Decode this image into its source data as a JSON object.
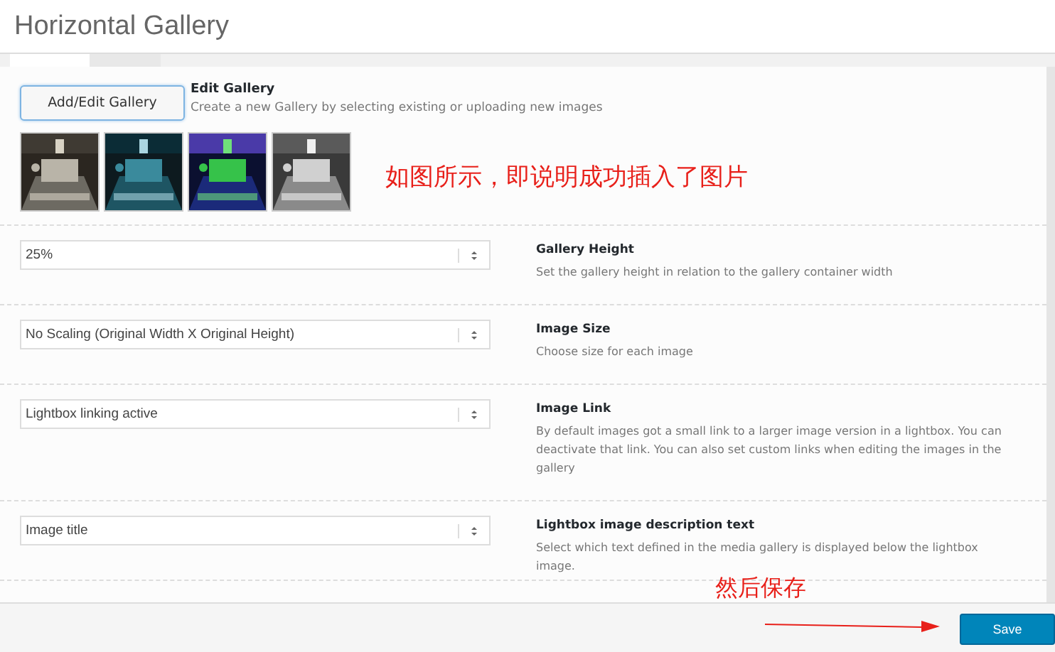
{
  "window": {
    "title": "Horizontal Gallery"
  },
  "tabs": [
    {
      "selected": true
    },
    {
      "selected": false
    }
  ],
  "gallery": {
    "button": "Add/Edit Gallery",
    "title": "Edit Gallery",
    "description": "Create a new Gallery by selecting existing or uploading new images"
  },
  "annotation_top": "如图所示，即说明成功插入了图片",
  "settings": [
    {
      "value": "25%",
      "title": "Gallery Height",
      "description": "Set the gallery height in relation to the gallery container width"
    },
    {
      "value": "No Scaling (Original Width X Original Height)",
      "title": "Image Size",
      "description": "Choose size for each image"
    },
    {
      "value": "Lightbox linking active",
      "title": "Image Link",
      "description": "By default images got a small link to a larger image version in a lightbox. You can deactivate that link. You can also set custom links when editing the images in the gallery"
    },
    {
      "value": "Image title",
      "title": "Lightbox image description text",
      "description": "Select which text defined in the media gallery is displayed below the lightbox image."
    }
  ],
  "annotation_bottom": "然后保存",
  "footer": {
    "button": "Save"
  }
}
